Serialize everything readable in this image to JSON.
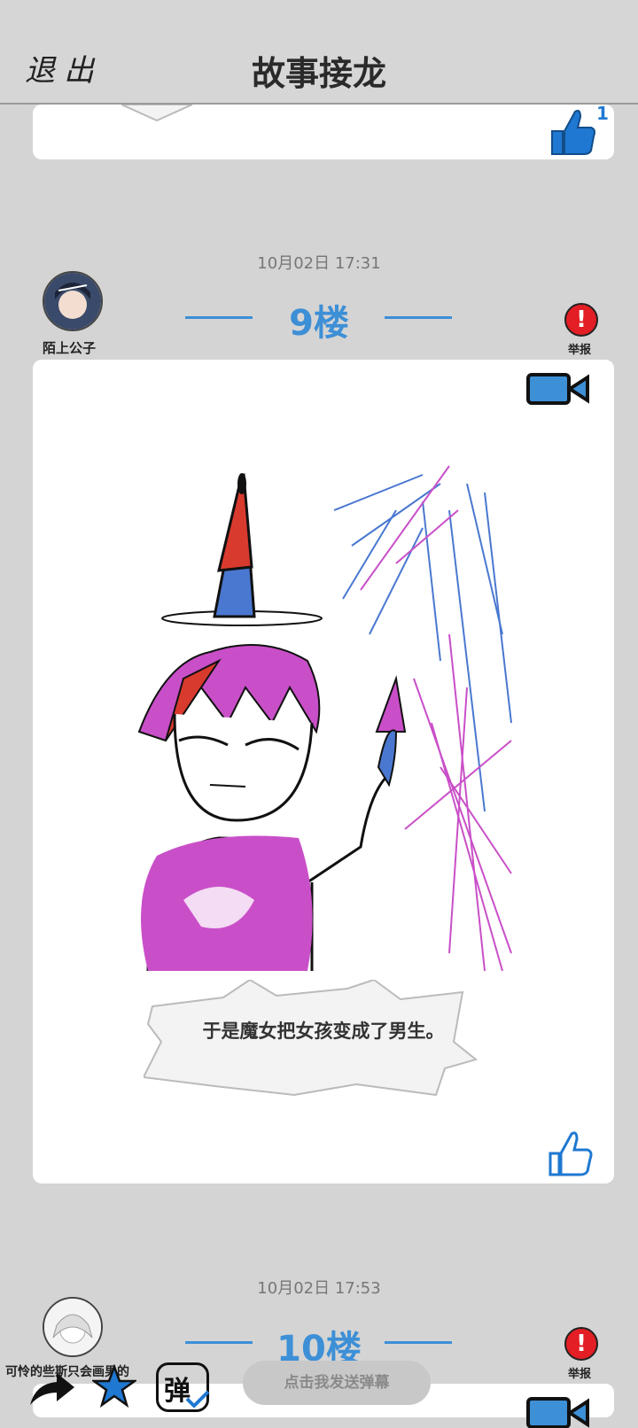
{
  "header": {
    "exit_label": "退出",
    "title": "故事接龙"
  },
  "prev_post": {
    "like_count": "1"
  },
  "posts": [
    {
      "timestamp": "10月02日  17:31",
      "username": "陌上公子",
      "floor": "9楼",
      "report_label": "举报",
      "caption": "于是魔女把女孩变成了男生。"
    },
    {
      "timestamp": "10月02日  17:53",
      "username": "可怜的些斯只会画男的",
      "floor": "10楼",
      "report_label": "举报"
    }
  ],
  "bottom_bar": {
    "danmaku_placeholder": "点击我发送弹幕",
    "danmaku_icon_text": "弹"
  },
  "colors": {
    "accent": "#3d8fd6",
    "report": "#e31e24",
    "background": "#d4d4d4"
  }
}
